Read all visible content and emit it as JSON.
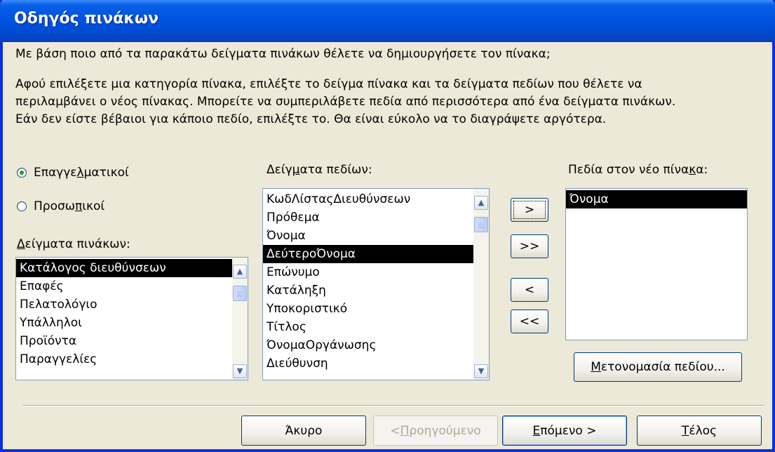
{
  "window": {
    "title": "Οδηγός πινάκων"
  },
  "intro": {
    "question": "Με βάση ποιο από τα παρακάτω δείγματα πινάκων θέλετε να δημιουργήσετε τον πίνακα;",
    "line1": "Αφού επιλέξετε μια κατηγορία πίνακα, επιλέξτε το δείγμα πίνακα και τα δείγματα πεδίων που θέλετε να",
    "line2": "περιλαμβάνει ο νέος πίνακας. Μπορείτε να συμπεριλάβετε πεδία από περισσότερα από ένα δείγματα πινάκων.",
    "line3": "Εάν δεν είστε βέβαιοι για κάποιο πεδίο, επιλέξτε το. Θα είναι εύκολο να το διαγράψετε αργότερα."
  },
  "category": {
    "options": [
      {
        "label_pre": "Επαγγε",
        "label_ul": "λ",
        "label_post": "ματικοί",
        "checked": true
      },
      {
        "label_pre": "Προσω",
        "label_ul": "π",
        "label_post": "ικοί",
        "checked": false
      }
    ]
  },
  "sample_tables": {
    "label_ul": "Δ",
    "label_post": "είγματα πινάκων:",
    "items": [
      "Κατάλογος διευθύνσεων",
      "Επαφές",
      "Πελατολόγιο",
      "Υπάλληλοι",
      "Προϊόντα",
      "Παραγγελίες"
    ],
    "selected_index": 0
  },
  "sample_fields": {
    "label_pre": "Δείγ",
    "label_ul": "μ",
    "label_post": "ατα πεδίων:",
    "items": [
      "ΚωδΛίσταςΔιευθύνσεων",
      "Πρόθεμα",
      "Όνομα",
      "ΔεύτεροΌνομα",
      "Επώνυμο",
      "Κατάληξη",
      "Υποκοριστικό",
      "Τίτλος",
      "ΌνομαΟργάνωσης",
      "Διεύθυνση"
    ],
    "selected_index": 3
  },
  "move_buttons": {
    "add_one": ">",
    "add_all": ">>",
    "remove_one": "<",
    "remove_all": "<<"
  },
  "new_table_fields": {
    "label_pre": "Πεδία στον νέο πίνα",
    "label_ul": "κ",
    "label_post": "α:",
    "items": [
      "Όνομα"
    ],
    "selected_index": 0
  },
  "rename_button": {
    "label_ul": "Μ",
    "label_post": "ετονομασία πεδίου..."
  },
  "footer": {
    "cancel": "Άκυρο",
    "back_pre": "< ",
    "back_ul": "Π",
    "back_post": "ροηγούμενο",
    "next_ul": "Ε",
    "next_post": "πόμενο >",
    "finish_ul": "Τ",
    "finish_post": "έλος"
  }
}
